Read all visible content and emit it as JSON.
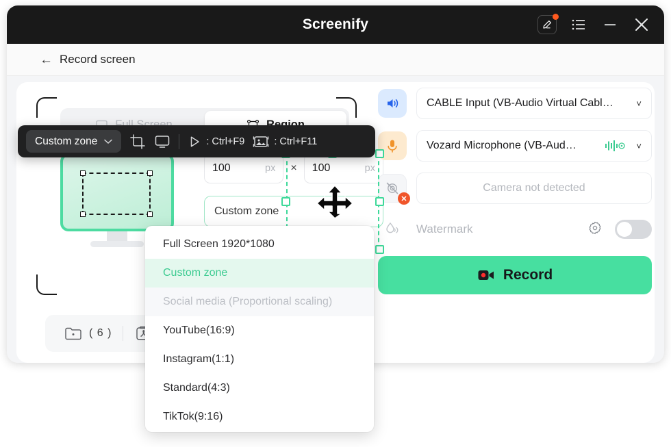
{
  "window": {
    "title": "Screenify",
    "titlebar_icons": [
      {
        "name": "edit-icon",
        "badge": true
      },
      {
        "name": "list-icon",
        "badge": false
      },
      {
        "name": "minimize-icon",
        "badge": false
      },
      {
        "name": "close-icon",
        "badge": false
      }
    ]
  },
  "subheader": {
    "back_arrow": "←",
    "back_label": "Record screen"
  },
  "capture": {
    "tabs": [
      {
        "label": "Full Screen",
        "icon": "monitor-icon",
        "active": false
      },
      {
        "label": "Region",
        "icon": "region-icon",
        "active": true
      }
    ],
    "width_value": "100",
    "width_unit": "px",
    "multiply": "×",
    "height_value": "100",
    "height_unit": "px",
    "zone_value": "Custom zone"
  },
  "bottom_strip": {
    "folder_icon": "folder-icon",
    "folder_count": "( 6 )",
    "tool_icon": "pdf-tool-icon"
  },
  "dark_toolbar": {
    "zone_label": "Custom zone",
    "chevron": "˅",
    "crop_icon": "crop-icon",
    "screen_icon": "screen-icon",
    "play_icon": "play-icon",
    "play_shortcut": ": Ctrl+F9",
    "capture_icon": "image-capture-icon",
    "capture_shortcut": ": Ctrl+F11"
  },
  "devices": {
    "speaker": {
      "icon": "speaker-icon",
      "label": "CABLE Input (VB-Audio Virtual Cabl…",
      "chevron": "˅"
    },
    "microphone": {
      "icon": "microphone-icon",
      "label": "Vozard Microphone (VB-Aud…",
      "level_icon": "audio-level-icon",
      "chevron": "˅"
    },
    "camera": {
      "icon": "camera-off-icon",
      "label": "Camera not detected",
      "badge": "✕"
    }
  },
  "watermark": {
    "icon": "watermark-icon",
    "label": "Watermark",
    "settings_icon": "gear-icon",
    "enabled": false
  },
  "record": {
    "icon": "camcorder-icon",
    "label": "Record"
  },
  "dropdown": {
    "items": [
      {
        "label": "Full Screen 1920*1080",
        "state": "normal"
      },
      {
        "label": "Custom zone",
        "state": "selected"
      },
      {
        "label": "Social media (Proportional scaling)",
        "state": "header"
      },
      {
        "label": "YouTube(16:9)",
        "state": "normal"
      },
      {
        "label": "Instagram(1:1)",
        "state": "normal"
      },
      {
        "label": "Standard(4:3)",
        "state": "normal"
      },
      {
        "label": "TikTok(9:16)",
        "state": "normal"
      }
    ]
  },
  "colors": {
    "accent_green": "#47dfa0",
    "selection_green": "#3ed99a",
    "dark_bar": "#202021",
    "badge_orange": "#ff5a1f",
    "camera_badge_red": "#f0552a"
  }
}
